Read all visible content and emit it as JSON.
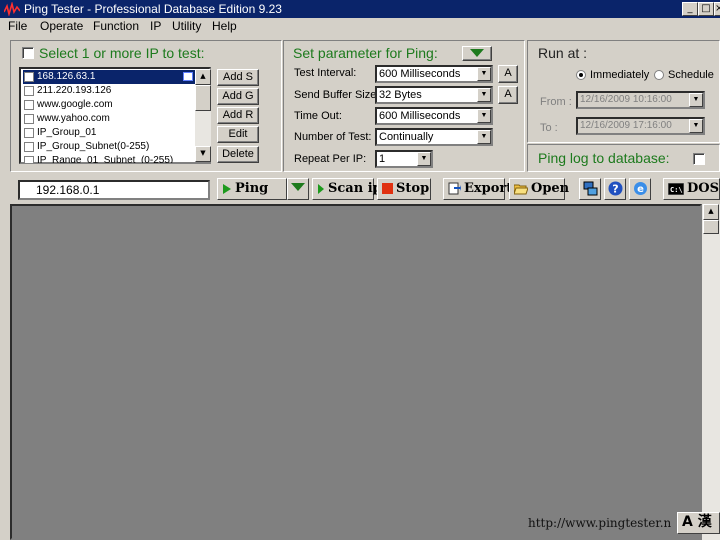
{
  "titlebar": {
    "title": "Ping Tester - Professional Database Edition  9.23",
    "minimize": "_",
    "maximize": "□",
    "close": "×"
  },
  "menu": [
    "File",
    "Operate",
    "Function",
    "IP",
    "Utility",
    "Help"
  ],
  "ip_select": {
    "heading": "Select 1 or more IP to test:",
    "items": [
      "168.126.63.1",
      "211.220.193.126",
      "www.google.com",
      "www.yahoo.com",
      "IP_Group_01",
      "IP_Group_Subnet(0-255)",
      "IP_Range_01_Subnet_(0-255)"
    ],
    "buttons": [
      "Add S",
      "Add G",
      "Add R",
      "Edit",
      "Delete"
    ]
  },
  "params": {
    "heading": "Set parameter for Ping:",
    "rows": [
      {
        "label": "Test Interval:",
        "value": "600  Milliseconds"
      },
      {
        "label": "Send Buffer Size:",
        "value": "32  Bytes"
      },
      {
        "label": "Time Out:",
        "value": "600  Milliseconds"
      },
      {
        "label": "Number of Test:",
        "value": "Continually"
      },
      {
        "label": "Repeat Per IP:",
        "value": "1"
      }
    ],
    "a_button": "A"
  },
  "run_at": {
    "heading": "Run at :",
    "immediately": "Immediately",
    "schedule": "Schedule",
    "from_label": "From :",
    "from_value": "12/16/2009 10:16:00",
    "to_label": "To :",
    "to_value": "12/16/2009 17:16:00"
  },
  "ping_log": {
    "label": "Ping log to database:"
  },
  "toolbar": {
    "ip_value": "192.168.0.1",
    "ping": "Ping",
    "scan_ip": "Scan ip",
    "stop": "Stop",
    "export": "Export",
    "open": "Open",
    "dos": "DOS"
  },
  "status": {
    "url": "http://www.pingtester.n",
    "ime": "A 漢"
  },
  "colors": {
    "heading_green": "#1d7a1d",
    "title_blue": "#0a246a",
    "content_gray": "#808080"
  }
}
